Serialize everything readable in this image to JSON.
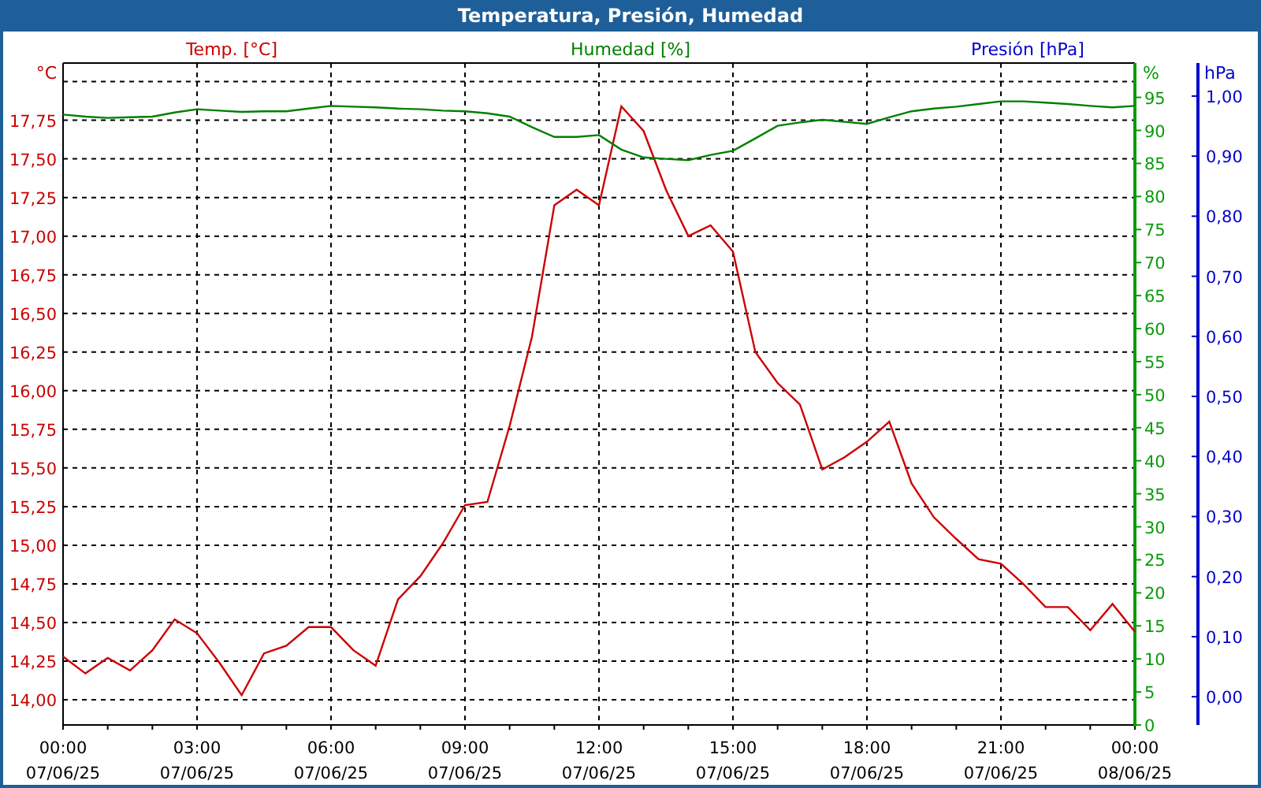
{
  "pressure_legend": {
    "label": "Presión [hPa]",
    "color": "#0000cc"
  },
  "chart_data": {
    "type": "line",
    "title": "Temperatura, Presión, Humedad",
    "grid": true,
    "categories": [
      "00:00\n07/06/25",
      null,
      null,
      null,
      null,
      null,
      "03:00\n07/06/25",
      null,
      null,
      null,
      null,
      null,
      "06:00\n07/06/25",
      null,
      null,
      null,
      null,
      null,
      "09:00\n07/06/25",
      null,
      null,
      null,
      null,
      null,
      "12:00\n07/06/25",
      null,
      null,
      null,
      null,
      null,
      "15:00\n07/06/25",
      null,
      null,
      null,
      null,
      null,
      "18:00\n07/06/25",
      null,
      null,
      null,
      null,
      null,
      "21:00\n07/06/25",
      null,
      null,
      null,
      null,
      null,
      "00:00\n08/06/25"
    ],
    "ylabel": "°C",
    "ylim": [
      13.837,
      18.12
    ],
    "yticks": [
      {
        "value": 14,
        "label": "14,00"
      },
      {
        "value": 14.25,
        "label": "14,25"
      },
      {
        "value": 14.5,
        "label": "14,50"
      },
      {
        "value": 14.75,
        "label": "14,75"
      },
      {
        "value": 15,
        "label": "15,00"
      },
      {
        "value": 15.25,
        "label": "15,25"
      },
      {
        "value": 15.5,
        "label": "15,50"
      },
      {
        "value": 15.75,
        "label": "15,75"
      },
      {
        "value": 16,
        "label": "16,00"
      },
      {
        "value": 16.25,
        "label": "16,25"
      },
      {
        "value": 16.5,
        "label": "16,50"
      },
      {
        "value": 16.75,
        "label": "16,75"
      },
      {
        "value": 17,
        "label": "17,00"
      },
      {
        "value": 17.25,
        "label": "17,25"
      },
      {
        "value": 17.5,
        "label": "17,50"
      },
      {
        "value": 17.75,
        "label": "17,75"
      }
    ],
    "y2label": "%",
    "y2lim": [
      0,
      100.2
    ],
    "y2ticks": [
      {
        "value": 0,
        "label": "0"
      },
      {
        "value": 5,
        "label": "5"
      },
      {
        "value": 10,
        "label": "10"
      },
      {
        "value": 15,
        "label": "15"
      },
      {
        "value": 20,
        "label": "20"
      },
      {
        "value": 25,
        "label": "25"
      },
      {
        "value": 30,
        "label": "30"
      },
      {
        "value": 35,
        "label": "35"
      },
      {
        "value": 40,
        "label": "40"
      },
      {
        "value": 45,
        "label": "45"
      },
      {
        "value": 50,
        "label": "50"
      },
      {
        "value": 55,
        "label": "55"
      },
      {
        "value": 60,
        "label": "60"
      },
      {
        "value": 65,
        "label": "65"
      },
      {
        "value": 70,
        "label": "70"
      },
      {
        "value": 75,
        "label": "75"
      },
      {
        "value": 80,
        "label": "80"
      },
      {
        "value": 85,
        "label": "85"
      },
      {
        "value": 90,
        "label": "90"
      },
      {
        "value": 95,
        "label": "95"
      }
    ],
    "y3label": "hPa",
    "y3lim": [
      -0.047,
      1.055
    ],
    "y3ticks": [
      {
        "value": 0,
        "label": "0,00"
      },
      {
        "value": 0.1,
        "label": "0,10"
      },
      {
        "value": 0.2,
        "label": "0,20"
      },
      {
        "value": 0.3,
        "label": "0,30"
      },
      {
        "value": 0.4,
        "label": "0,40"
      },
      {
        "value": 0.5,
        "label": "0,50"
      },
      {
        "value": 0.6,
        "label": "0,60"
      },
      {
        "value": 0.7,
        "label": "0,70"
      },
      {
        "value": 0.8,
        "label": "0,80"
      },
      {
        "value": 0.9,
        "label": "0,90"
      },
      {
        "value": 1,
        "label": "1,00"
      }
    ],
    "series": [
      {
        "name": "Temp. [°C]",
        "color": "#cc0000",
        "axis": "y",
        "values": [
          14.28,
          14.17,
          14.27,
          14.19,
          14.32,
          14.52,
          14.43,
          14.24,
          14.03,
          14.3,
          14.35,
          14.47,
          14.47,
          14.32,
          14.22,
          14.65,
          14.8,
          15.01,
          15.26,
          15.28,
          15.77,
          16.35,
          17.2,
          17.3,
          17.2,
          17.84,
          17.68,
          17.3,
          17.0,
          17.07,
          16.9,
          16.25,
          16.05,
          15.91,
          15.49,
          15.57,
          15.67,
          15.8,
          15.4,
          15.18,
          15.04,
          14.91,
          14.88,
          14.75,
          14.6,
          14.6,
          14.45,
          14.62,
          14.44
        ]
      },
      {
        "name": "Humedad [%]",
        "color": "#008000",
        "axis": "y2",
        "values": [
          92.4,
          92.1,
          91.9,
          92.0,
          92.1,
          92.7,
          93.2,
          93.0,
          92.8,
          92.9,
          92.9,
          93.3,
          93.7,
          93.6,
          93.5,
          93.3,
          93.2,
          93.0,
          92.9,
          92.6,
          92.1,
          90.5,
          89.0,
          89.0,
          89.3,
          87.1,
          85.9,
          85.7,
          85.5,
          86.3,
          86.9,
          88.8,
          90.7,
          91.2,
          91.6,
          91.3,
          91.0,
          92.0,
          92.9,
          93.3,
          93.6,
          94.0,
          94.4,
          94.4,
          94.2,
          94.0,
          93.7,
          93.5,
          93.7
        ]
      }
    ]
  }
}
